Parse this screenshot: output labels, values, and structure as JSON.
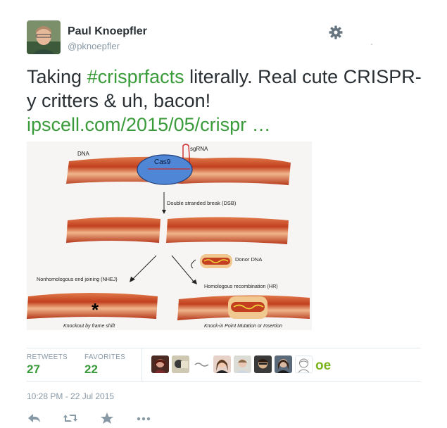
{
  "author": {
    "name": "Paul Knoepfler",
    "handle": "@pknoepfler"
  },
  "icons": {
    "avatar": "user-avatar",
    "settings": "gear-icon",
    "reply": "reply-icon",
    "retweet": "retweet-icon",
    "favorite": "star-icon",
    "more": "more-dots-icon"
  },
  "tweet": {
    "text_part1": "Taking ",
    "hashtag": "#crisprfacts",
    "text_part2": " literally. Real cute CRISPR-y critters & uh, bacon! ",
    "link": "ipscell.com/2015/05/crispr …"
  },
  "media": {
    "labels": {
      "dna": "DNA",
      "sgrna": "sgRNA",
      "cas9": "Cas9",
      "dsb": "Double stranded break (DSB)",
      "donor": "Donor DNA",
      "nhej": "Nonhomologous end joining (NHEJ)",
      "hr": "Homologous recombination (HR)",
      "knockout": "Knockout by frame shift",
      "knockin": "Knock-in Point Mutation or Insertion",
      "star": "*"
    }
  },
  "stats": {
    "retweets_label": "RETWEETS",
    "retweets_value": "27",
    "favorites_label": "FAVORITES",
    "favorites_value": "22",
    "last_avatar_text": "oe"
  },
  "timestamp": "10:28 PM - 22 Jul 2015",
  "colors": {
    "link": "#3a9b3a",
    "text": "#292f33",
    "muted": "#8899a6",
    "bacon": "#c9502c",
    "cas9": "#4f86d6"
  }
}
